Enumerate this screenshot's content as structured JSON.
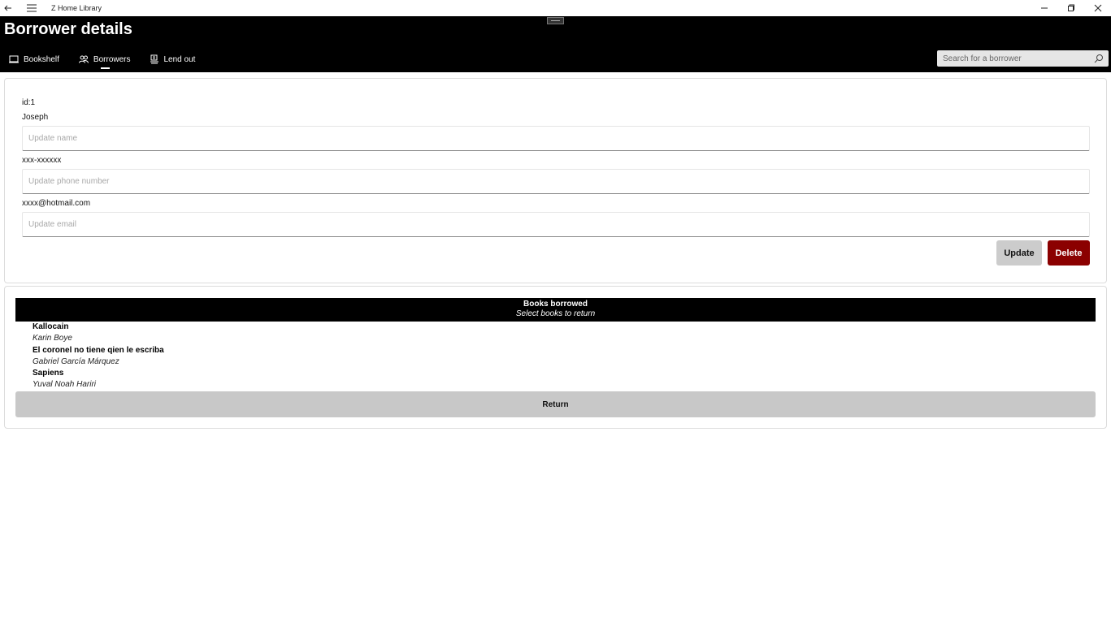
{
  "window": {
    "app_title": "Z Home Library"
  },
  "header": {
    "page_title": "Borrower details",
    "nav": [
      {
        "label": "Bookshelf",
        "icon": "book-icon"
      },
      {
        "label": "Borrowers",
        "icon": "people-icon",
        "active": true
      },
      {
        "label": "Lend out",
        "icon": "lend-icon"
      }
    ],
    "search_placeholder": "Search for a borrower"
  },
  "borrower": {
    "id_label": "id:1",
    "name": "Joseph",
    "name_placeholder": "Update name",
    "phone": "xxx-xxxxxx",
    "phone_placeholder": "Update phone number",
    "email": "xxxx@hotmail.com",
    "email_placeholder": "Update email",
    "update_label": "Update",
    "delete_label": "Delete"
  },
  "books": {
    "title": "Books borrowed",
    "subtitle": "Select books to return",
    "items": [
      {
        "title": "Kallocain",
        "author": "Karin Boye"
      },
      {
        "title": "El coronel no tiene qien le escriba",
        "author": "Gabriel García Márquez"
      },
      {
        "title": "Sapiens",
        "author": "Yuval Noah Hariri"
      }
    ],
    "return_label": "Return"
  },
  "colors": {
    "header_bg": "#000000",
    "delete_bg": "#8b0000",
    "update_bg": "#cccccc",
    "return_bg": "#c8c8c8"
  }
}
